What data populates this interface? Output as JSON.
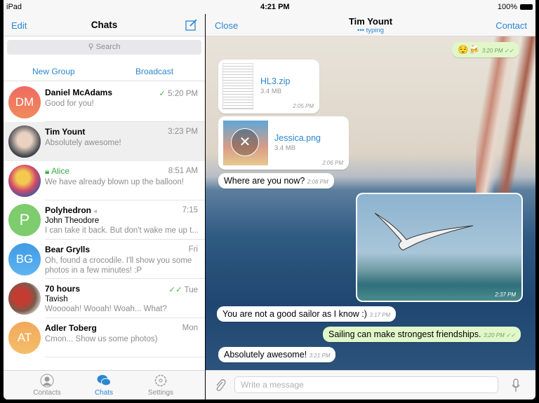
{
  "status": {
    "device": "iPad",
    "time": "4:21 PM",
    "battery": "100%"
  },
  "left": {
    "header": {
      "edit": "Edit",
      "title": "Chats"
    },
    "search_placeholder": "Search",
    "new_group": "New Group",
    "broadcast": "Broadcast",
    "chats": [
      {
        "name": "Daniel McAdams",
        "initials": "DM",
        "color": "#ee6e5e",
        "time": "5:20 PM",
        "line1": "Good for you!",
        "status": "read"
      },
      {
        "name": "Tim Yount",
        "time": "3:23 PM",
        "line1": "Absolutely awesome!",
        "selected": true
      },
      {
        "name": "Alice",
        "time": "8:51 AM",
        "line1": "We have already blown up the balloon!",
        "secret": true
      },
      {
        "name": "Polyhedron",
        "initials": "P",
        "color": "#7dcc6e",
        "time": "7:15",
        "sender": "John Theodore",
        "line1": "I can take it back. But don't wake me up t...",
        "muted": true
      },
      {
        "name": "Bear Grylls",
        "initials": "BG",
        "color": "#4fa6ea",
        "time": "Fri",
        "line1": "Oh, found a crocodile. I'll show you some",
        "line2": "photos in a few minutes! :P"
      },
      {
        "name": "70 hours",
        "time": "Tue",
        "sender": "Tavish",
        "line1": "Wooooah! Wooah! Woah... What?",
        "status": "double-read"
      },
      {
        "name": "Adler Toberg",
        "initials": "AT",
        "color": "#f3b05d",
        "time": "Mon",
        "line1": "Cmon... Show us some photos)"
      }
    ],
    "tabs": [
      {
        "label": "Contacts",
        "icon": "person-icon"
      },
      {
        "label": "Chats",
        "icon": "chat-bubbles-icon",
        "active": true
      },
      {
        "label": "Settings",
        "icon": "gear-icon"
      }
    ]
  },
  "right": {
    "header": {
      "close": "Close",
      "title": "Tim Yount",
      "subtitle": "typing",
      "contact": "Contact"
    },
    "messages": [
      {
        "dir": "out",
        "text": "😌🍻",
        "time": "3:20 PM"
      },
      {
        "dir": "in",
        "type": "file",
        "name": "HL3.zip",
        "size": "3.4 MB",
        "time": "2:05 PM"
      },
      {
        "dir": "in",
        "type": "image-file",
        "name": "Jessica.png",
        "size": "3.4 MB",
        "time": "2:06 PM"
      },
      {
        "dir": "in",
        "text": "Where are you now?",
        "time": "2:08 PM"
      },
      {
        "dir": "out",
        "type": "photo",
        "time": "2:37 PM"
      },
      {
        "dir": "in",
        "text": "You are not a good sailor as I know :)",
        "time": "3:17 PM"
      },
      {
        "dir": "out",
        "text": "Sailing can make strongest friendships.",
        "time": "3:20 PM"
      },
      {
        "dir": "in",
        "text": "Absolutely awesome!",
        "time": "3:21 PM"
      }
    ],
    "input_placeholder": "Write a message"
  },
  "colors": {
    "accent": "#2a86d0",
    "green": "#4caf50",
    "outgoing": "#e1f7c9"
  }
}
